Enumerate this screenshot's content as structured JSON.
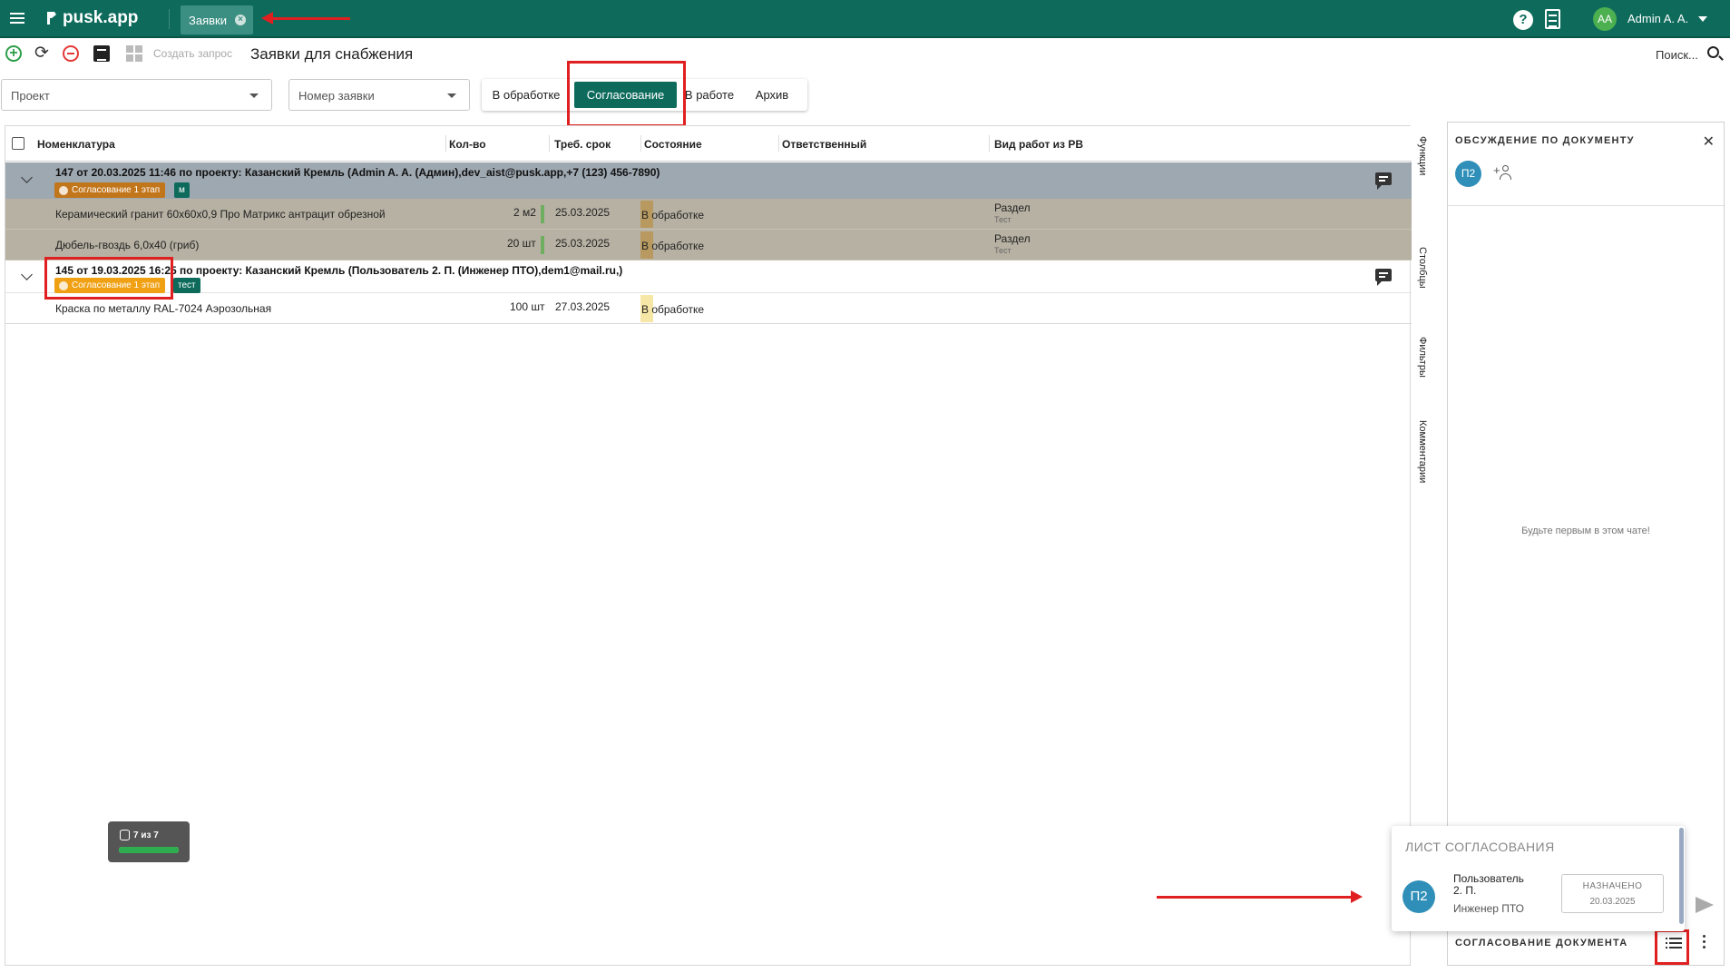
{
  "app": {
    "logo_text": "pusk.app",
    "top_tab_label": "Заявки",
    "user_initials": "AA",
    "user_name": "Admin A. A.",
    "brand_color": "#0e6b5c"
  },
  "toolbar": {
    "create_label": "Создать запрос",
    "page_title": "Заявки для снабжения",
    "search_label": "Поиск..."
  },
  "filters": {
    "project_placeholder": "Проект",
    "number_placeholder": "Номер заявки"
  },
  "status_tabs": [
    "В обработке",
    "Согласование",
    "В работе",
    "Архив"
  ],
  "status_tab_active": "Согласование",
  "grid": {
    "columns": [
      "Номенклатура",
      "Кол-во",
      "Треб. срок",
      "Состояние",
      "Ответственный",
      "Вид работ из РВ"
    ],
    "groups": [
      {
        "title": "147 от 20.03.2025 11:46 по проекту: Казанский Кремль (Admin A. A. (Админ),dev_aist@pusk.app,+7 (123) 456-7890)",
        "stage_badge": "Согласование 1 этап",
        "tag": "м",
        "stage_color": "#c2761b",
        "items": [
          {
            "name": "Керамический гранит 60x60x0,9 Про Матрикс антрацит обрезной",
            "qty": "2 м2",
            "date": "25.03.2025",
            "state": "В обработке",
            "work_type": "Раздел",
            "work_sub": "Тест"
          },
          {
            "name": "Дюбель-гвоздь 6,0x40 (гриб)",
            "qty": "20 шт",
            "date": "25.03.2025",
            "state": "В обработке",
            "work_type": "Раздел",
            "work_sub": "Тест"
          }
        ]
      },
      {
        "title": "145 от 19.03.2025 16:25 по проекту: Казанский Кремль (Пользователь 2. П. (Инженер ПТО),dem1@mail.ru,)",
        "stage_badge": "Согласование 1 этап",
        "tag": "тест",
        "stage_color": "#f0a013",
        "items": [
          {
            "name": "Краска по металлу RAL-7024 Аэрозольная",
            "qty": "100 шт",
            "date": "27.03.2025",
            "state": "В обработке",
            "work_type": "",
            "work_sub": ""
          }
        ]
      }
    ]
  },
  "side_strip": [
    "Функции",
    "Столбцы",
    "Фильтры",
    "Комментарии"
  ],
  "discussion": {
    "title": "ОБСУЖДЕНИЕ ПО ДОКУМЕНТУ",
    "participant_initials": "П2",
    "empty_text": "Будьте первым в этом чате!",
    "bottom_title": "СОГЛАСОВАНИЕ ДОКУМЕНТА"
  },
  "approval_popup": {
    "title": "ЛИСТ СОГЛАСОВАНИЯ",
    "avatar_initials": "П2",
    "name": "Пользователь 2. П.",
    "role": "Инженер ПТО",
    "status": "НАЗНАЧЕНО",
    "status_date": "20.03.2025"
  },
  "counter": {
    "label": "7 из 7",
    "progress_fraction": 1.0
  }
}
